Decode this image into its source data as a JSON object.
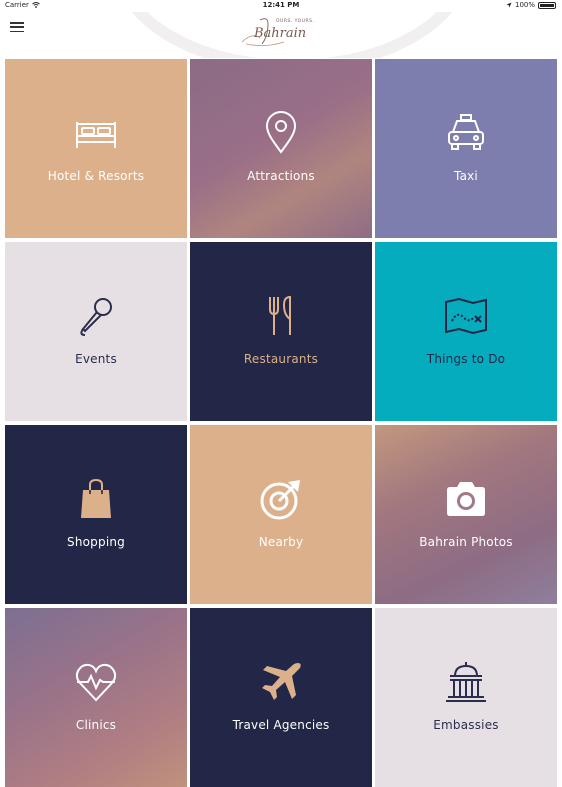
{
  "status": {
    "carrier": "Carrier",
    "time": "12:41 PM",
    "battery": "100%"
  },
  "header": {
    "logo_tagline": "OURS. YOURS.",
    "logo_word": "Bahrain"
  },
  "tiles": [
    {
      "label": "Hotel & Resorts",
      "icon": "bed-icon",
      "background": "#dcb08a",
      "text_color": "#ffffff"
    },
    {
      "label": "Attractions",
      "icon": "map-pin-icon",
      "background": "#8e6c86",
      "text_color": "#ffffff"
    },
    {
      "label": "Taxi",
      "icon": "taxi-icon",
      "background": "#7e7eae",
      "text_color": "#ffffff"
    },
    {
      "label": "Events",
      "icon": "microphone-icon",
      "background": "#e6e0e4",
      "text_color": "#2b2d4d"
    },
    {
      "label": "Restaurants",
      "icon": "fork-knife-icon",
      "background": "#222747",
      "text_color": "#dcb08a"
    },
    {
      "label": "Things to Do",
      "icon": "treasure-map-icon",
      "background": "#04acbe",
      "text_color": "#222747"
    },
    {
      "label": "Shopping",
      "icon": "shopping-bag-icon",
      "background": "#222747",
      "text_color": "#ffffff"
    },
    {
      "label": "Nearby",
      "icon": "target-arrow-icon",
      "background": "#dcb08a",
      "text_color": "#ffffff"
    },
    {
      "label": "Bahrain Photos",
      "icon": "camera-icon",
      "background": "#a37a83",
      "text_color": "#ffffff"
    },
    {
      "label": "Clinics",
      "icon": "heartbeat-icon",
      "background": "#9c7589",
      "text_color": "#ffffff"
    },
    {
      "label": "Travel Agencies",
      "icon": "airplane-icon",
      "background": "#222747",
      "text_color": "#ffffff"
    },
    {
      "label": "Embassies",
      "icon": "building-dome-icon",
      "background": "#e6e0e4",
      "text_color": "#2b2d4d"
    }
  ]
}
